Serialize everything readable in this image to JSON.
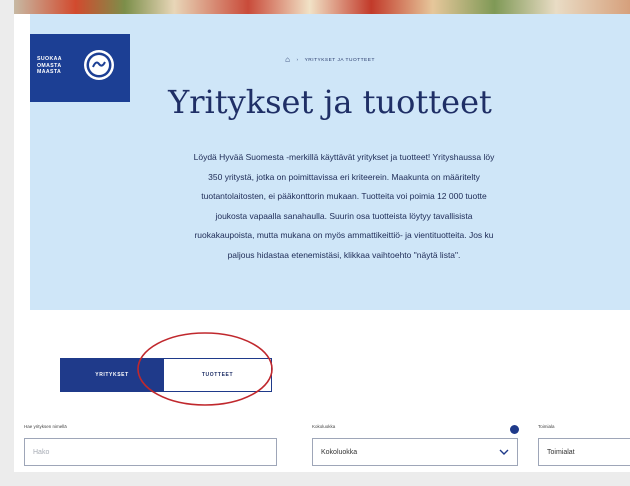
{
  "logo": {
    "text_lines": [
      "SUOKAA",
      "OMASTA",
      "MAASTA"
    ],
    "badge_text": "avainlippu"
  },
  "breadcrumb": {
    "home_icon": "home-icon",
    "separator": "›",
    "current": "YRITYKSET JA TUOTTEET"
  },
  "hero": {
    "title": "Yritykset ja tuotteet",
    "description_lines": [
      "Löydä Hyvää Suomesta -merkillä käyttävät yritykset ja tuotteet! Yrityshaussa löy",
      "350 yritystä, jotka on poimittavissa eri kriteerein. Maakunta on määritelty",
      "tuotantolaitosten, ei pääkonttorin mukaan. Tuotteita voi poimia 12 000 tuotte",
      "joukosta vapaalla sanahaulla. Suurin osa tuotteista löytyy tavallisista",
      "ruokakaupoista, mutta mukana on myös ammattikeittiö- ja vientituotteita. Jos ku",
      "paljous hidastaa etenemistäsi, klikkaa vaihtoehto \"näytä lista\"."
    ]
  },
  "tabs": [
    {
      "label": "YRITYKSET",
      "active": true
    },
    {
      "label": "TUOTTEET",
      "active": false
    }
  ],
  "filters": {
    "search": {
      "label": "Hae yrityksen nimellä",
      "placeholder": "Hako"
    },
    "category": {
      "label": "Kokoluokka",
      "value": "Kokoluokka"
    },
    "location": {
      "label": "Toimiala",
      "value": "Toimialat"
    }
  },
  "colors": {
    "hero_bg": "#cfe6f8",
    "brand_blue": "#1f3a8a",
    "annotation_red": "#c0282d"
  }
}
